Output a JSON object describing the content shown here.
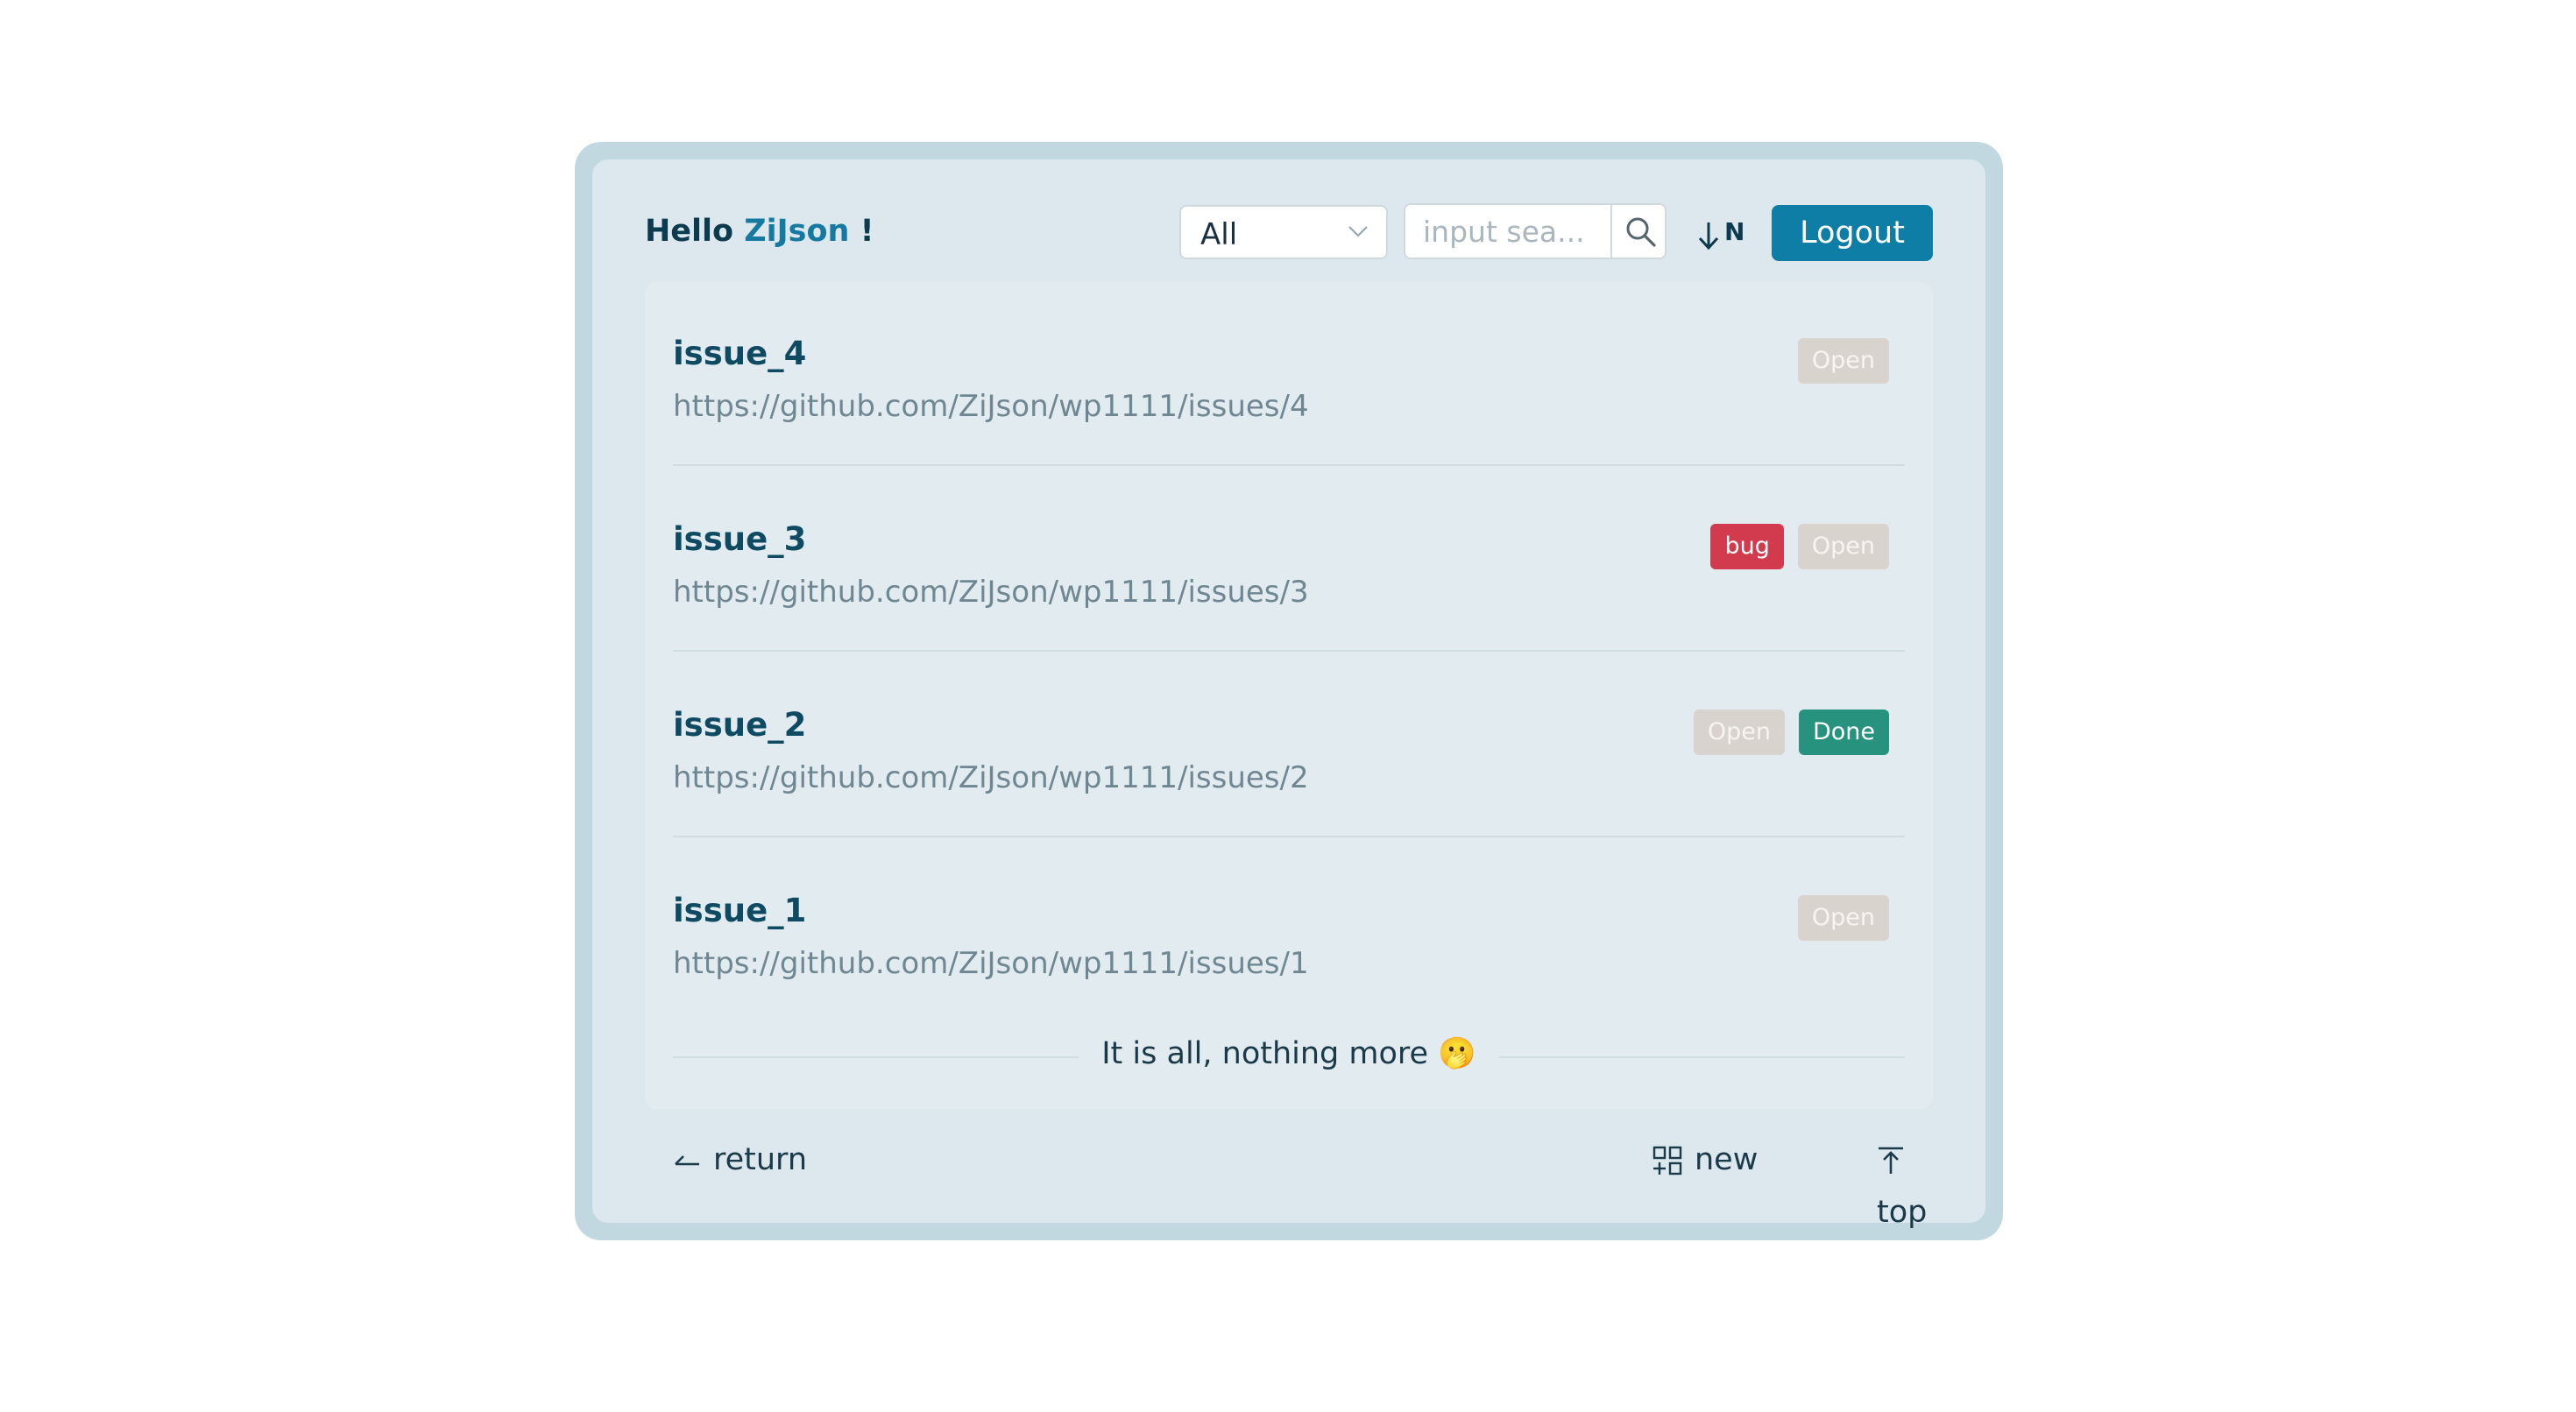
{
  "header": {
    "greeting_prefix": "Hello",
    "username": "ZiJson",
    "greeting_suffix": "!",
    "filter_selected": "All",
    "search_placeholder": "input sea...",
    "sort_label": "N",
    "logout_label": "Logout"
  },
  "issues": [
    {
      "title": "issue_4",
      "url": "https://github.com/ZiJson/wp1111/issues/4",
      "tags": [
        "Open"
      ]
    },
    {
      "title": "issue_3",
      "url": "https://github.com/ZiJson/wp1111/issues/3",
      "tags": [
        "bug",
        "Open"
      ]
    },
    {
      "title": "issue_2",
      "url": "https://github.com/ZiJson/wp1111/issues/2",
      "tags": [
        "Open",
        "Done"
      ]
    },
    {
      "title": "issue_1",
      "url": "https://github.com/ZiJson/wp1111/issues/1",
      "tags": [
        "Open"
      ]
    }
  ],
  "end_message": "It is all, nothing more 🫢",
  "footer": {
    "return_label": "return",
    "new_label": "new",
    "top_label": "top"
  },
  "colors": {
    "primary": "#0f7ea6",
    "tag_open": "#d8d3cc",
    "tag_bug": "#d23a4e",
    "tag_done": "#27937f",
    "frame": "#c2d8e0",
    "panel": "#dce8ee"
  }
}
